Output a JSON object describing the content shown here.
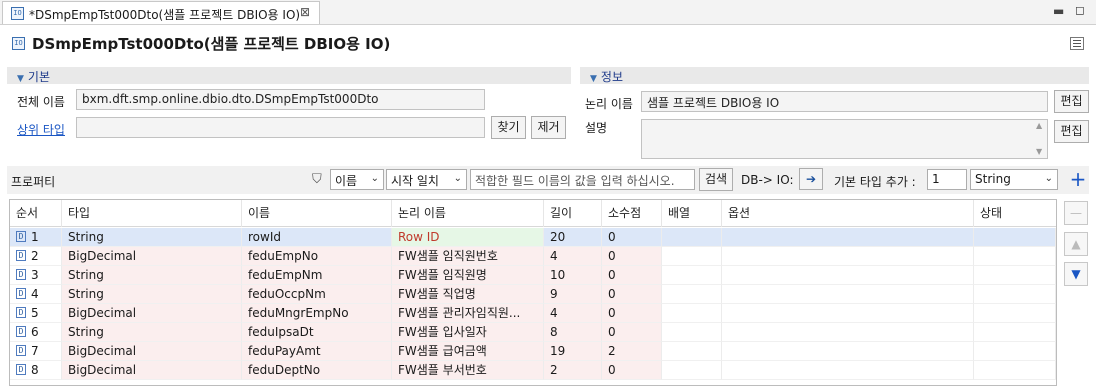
{
  "tab": {
    "title": "*DSmpEmpTst000Dto(샘플 프로젝트 DBIO용 IO)",
    "icon": "io-icon"
  },
  "editor": {
    "title": "DSmpEmpTst000Dto(샘플 프로젝트 DBIO용 IO)"
  },
  "basic": {
    "header": "기본",
    "fullname_label": "전체 이름",
    "fullname_value": "bxm.dft.smp.online.dbio.dto.DSmpEmpTst000Dto",
    "parent_label": "상위 타입",
    "parent_value": "",
    "find_label": "찾기",
    "remove_label": "제거"
  },
  "info": {
    "header": "정보",
    "logical_label": "논리 이름",
    "logical_value": "샘플 프로젝트 DBIO용 IO",
    "desc_label": "설명",
    "desc_value": "",
    "edit_label": "편집"
  },
  "property": {
    "header": "프로퍼티",
    "filter_field": "이름",
    "filter_mode": "시작 일치",
    "search_placeholder": "적합한 필드 이름의 값을 입력 하십시오.",
    "search_label": "검색",
    "db_io_label": "DB-> IO:",
    "add_type_label": "기본 타입 추가 :",
    "add_count": "1",
    "add_type": "String"
  },
  "table": {
    "columns": [
      "순서",
      "타입",
      "이름",
      "논리 이름",
      "길이",
      "소수점",
      "배열",
      "옵션",
      "상태"
    ],
    "rows": [
      {
        "seq": "1",
        "type": "String",
        "name": "rowId",
        "logical": "Row ID",
        "length": "20",
        "decimal": "0"
      },
      {
        "seq": "2",
        "type": "BigDecimal",
        "name": "feduEmpNo",
        "logical": "FW샘플 임직원번호",
        "length": "4",
        "decimal": "0"
      },
      {
        "seq": "3",
        "type": "String",
        "name": "feduEmpNm",
        "logical": "FW샘플 임직원명",
        "length": "10",
        "decimal": "0"
      },
      {
        "seq": "4",
        "type": "String",
        "name": "feduOccpNm",
        "logical": "FW샘플 직업명",
        "length": "9",
        "decimal": "0"
      },
      {
        "seq": "5",
        "type": "BigDecimal",
        "name": "feduMngrEmpNo",
        "logical": "FW샘플 관리자임직원...",
        "length": "4",
        "decimal": "0"
      },
      {
        "seq": "6",
        "type": "String",
        "name": "feduIpsaDt",
        "logical": "FW샘플 입사일자",
        "length": "8",
        "decimal": "0"
      },
      {
        "seq": "7",
        "type": "BigDecimal",
        "name": "feduPayAmt",
        "logical": "FW샘플 급여금액",
        "length": "19",
        "decimal": "2"
      },
      {
        "seq": "8",
        "type": "BigDecimal",
        "name": "feduDeptNo",
        "logical": "FW샘플 부서번호",
        "length": "2",
        "decimal": "0"
      }
    ]
  },
  "colors": {
    "selected_row": "#dce7f8",
    "row_tint": "#fbeeee",
    "selected_logical_bg": "#e6f7e6",
    "row_id_text": "#c0392b",
    "section_header": "#e9e9e9",
    "accent": "#1a56c4"
  }
}
